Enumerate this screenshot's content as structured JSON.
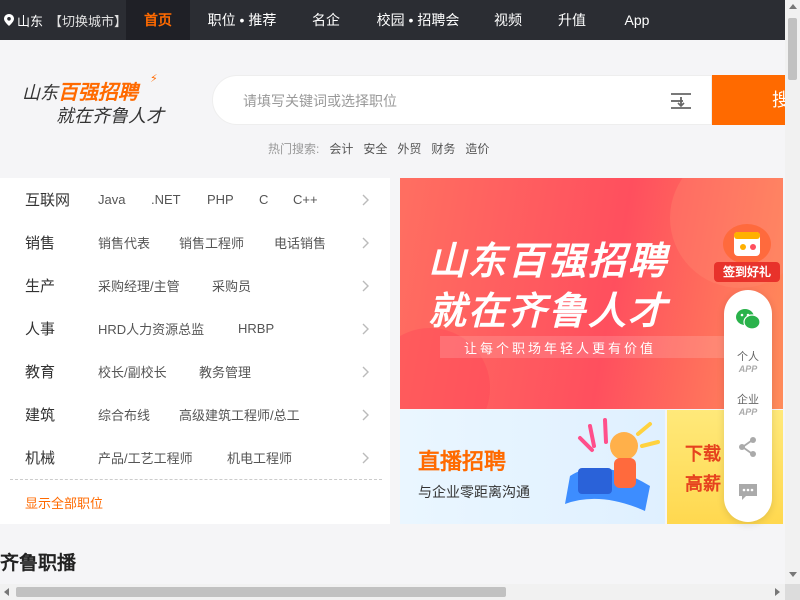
{
  "colors": {
    "accent": "#ff6a00",
    "nav_bg": "#2b2d33",
    "gift_red": "#e8322b"
  },
  "topnav": {
    "location": "山东",
    "switch_city": "【切换城市】",
    "items": [
      "首页",
      "职位 • 推荐",
      "名企",
      "校园 • 招聘会",
      "视频",
      "升值",
      "App"
    ],
    "active": "首页"
  },
  "logo": {
    "line1_prefix": "山东",
    "line1_highlight": "百强招聘",
    "line2": "就在齐鲁人才"
  },
  "search": {
    "placeholder": "请填写关键词或选择职位",
    "button_label": "搜索",
    "filter_icon": "filter-icon"
  },
  "hot": {
    "label": "热门搜索:",
    "keywords": [
      "会计",
      "安全",
      "外贸",
      "财务",
      "造价"
    ]
  },
  "categories": [
    {
      "name": "互联网",
      "subs": [
        "Java",
        ".NET",
        "PHP",
        "C",
        "C++"
      ]
    },
    {
      "name": "销售",
      "subs": [
        "销售代表",
        "销售工程师",
        "电话销售"
      ]
    },
    {
      "name": "生产",
      "subs": [
        "采购经理/主管",
        "采购员"
      ]
    },
    {
      "name": "人事",
      "subs": [
        "HRD人力资源总监",
        "HRBP"
      ]
    },
    {
      "name": "教育",
      "subs": [
        "校长/副校长",
        "教务管理"
      ]
    },
    {
      "name": "建筑",
      "subs": [
        "综合布线",
        "高级建筑工程师/总工"
      ]
    },
    {
      "name": "机械",
      "subs": [
        "产品/工艺工程师",
        "机电工程师"
      ]
    }
  ],
  "show_all": "显示全部职位",
  "banner_main": {
    "line1": "山东百强招聘",
    "line2": "就在齐鲁人才",
    "tagline": "让每个职场年轻人更有价值"
  },
  "banner_live": {
    "title": "直播招聘",
    "subtitle": "与企业零距离沟通"
  },
  "banner_download": {
    "line1": "下载",
    "line2": "高薪"
  },
  "float_bar": {
    "gift_label": "签到好礼",
    "wechat_icon": "wechat-icon",
    "personal": {
      "cap": "个人",
      "sub": "APP"
    },
    "company": {
      "cap": "企业",
      "sub": "APP"
    },
    "share_icon": "share-icon",
    "chat_icon": "chat-icon"
  },
  "section_title": "齐鲁职播"
}
